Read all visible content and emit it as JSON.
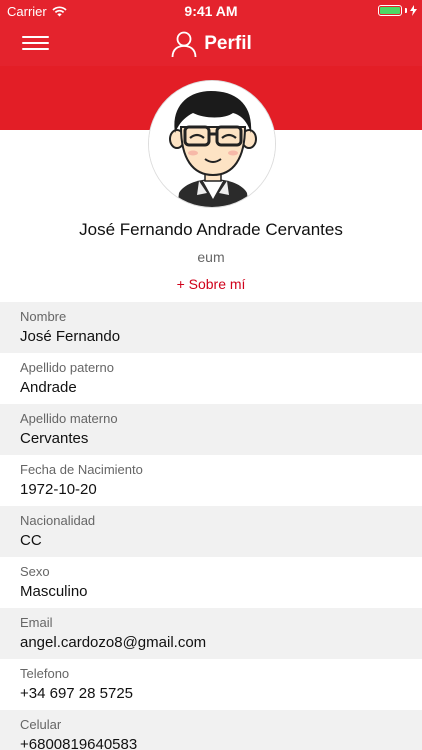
{
  "status_bar": {
    "carrier": "Carrier",
    "time": "9:41 AM"
  },
  "nav": {
    "title": "Perfil"
  },
  "profile": {
    "full_name": "José Fernando Andrade Cervantes",
    "subtitle": "eum",
    "about_link": "+ Sobre mí"
  },
  "fields": [
    {
      "label": "Nombre",
      "value": "José Fernando"
    },
    {
      "label": "Apellido paterno",
      "value": "Andrade"
    },
    {
      "label": "Apellido materno",
      "value": "Cervantes"
    },
    {
      "label": "Fecha de Nacimiento",
      "value": "1972-10-20"
    },
    {
      "label": "Nacionalidad",
      "value": "CC"
    },
    {
      "label": "Sexo",
      "value": "Masculino"
    },
    {
      "label": "Email",
      "value": "angel.cardozo8@gmail.com"
    },
    {
      "label": "Telefono",
      "value": "+34 697 28 5725"
    },
    {
      "label": "Celular",
      "value": "+6800819640583"
    }
  ],
  "colors": {
    "brand_red": "#e4232d",
    "link_red": "#d0021b",
    "row_gray": "#f1f1f1",
    "battery_green": "#4cd964"
  },
  "icons": [
    "wifi-icon",
    "battery-icon",
    "charging-icon",
    "hamburger-menu-icon",
    "user-icon"
  ]
}
